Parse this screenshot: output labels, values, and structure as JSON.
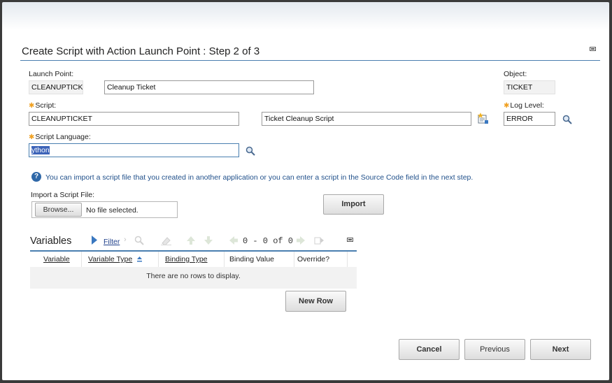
{
  "dialog": {
    "title": "Create Script with Action Launch Point : Step 2 of 3"
  },
  "launch_point": {
    "label": "Launch Point:",
    "value": "CLEANUPTICKE",
    "description": "Cleanup Ticket"
  },
  "object": {
    "label": "Object:",
    "value": "TICKET"
  },
  "script": {
    "label": "Script:",
    "value": "CLEANUPTICKET",
    "description": "Ticket Cleanup Script"
  },
  "log_level": {
    "label": "Log Level:",
    "value": "ERROR"
  },
  "script_language": {
    "label": "Script Language:",
    "value": "ython"
  },
  "info": {
    "icon": "?",
    "text": "You can import a script file that you created in another application or you can enter a script in the Source Code field in the next step."
  },
  "import": {
    "label": "Import a Script File:",
    "browse_label": "Browse...",
    "file_status": "No file selected.",
    "import_button": "Import"
  },
  "variables": {
    "title": "Variables",
    "filter_label": "Filter",
    "pager": "0 - 0 of 0",
    "columns": [
      "Variable",
      "Variable Type",
      "Binding Type",
      "Binding Value",
      "Override?"
    ],
    "empty_message": "There are no rows to display.",
    "new_row_label": "New Row"
  },
  "footer": {
    "cancel": "Cancel",
    "previous": "Previous",
    "next": "Next"
  },
  "colors": {
    "accent": "#4a7fb0",
    "required": "#f0a020",
    "link": "#1f4f8a"
  }
}
